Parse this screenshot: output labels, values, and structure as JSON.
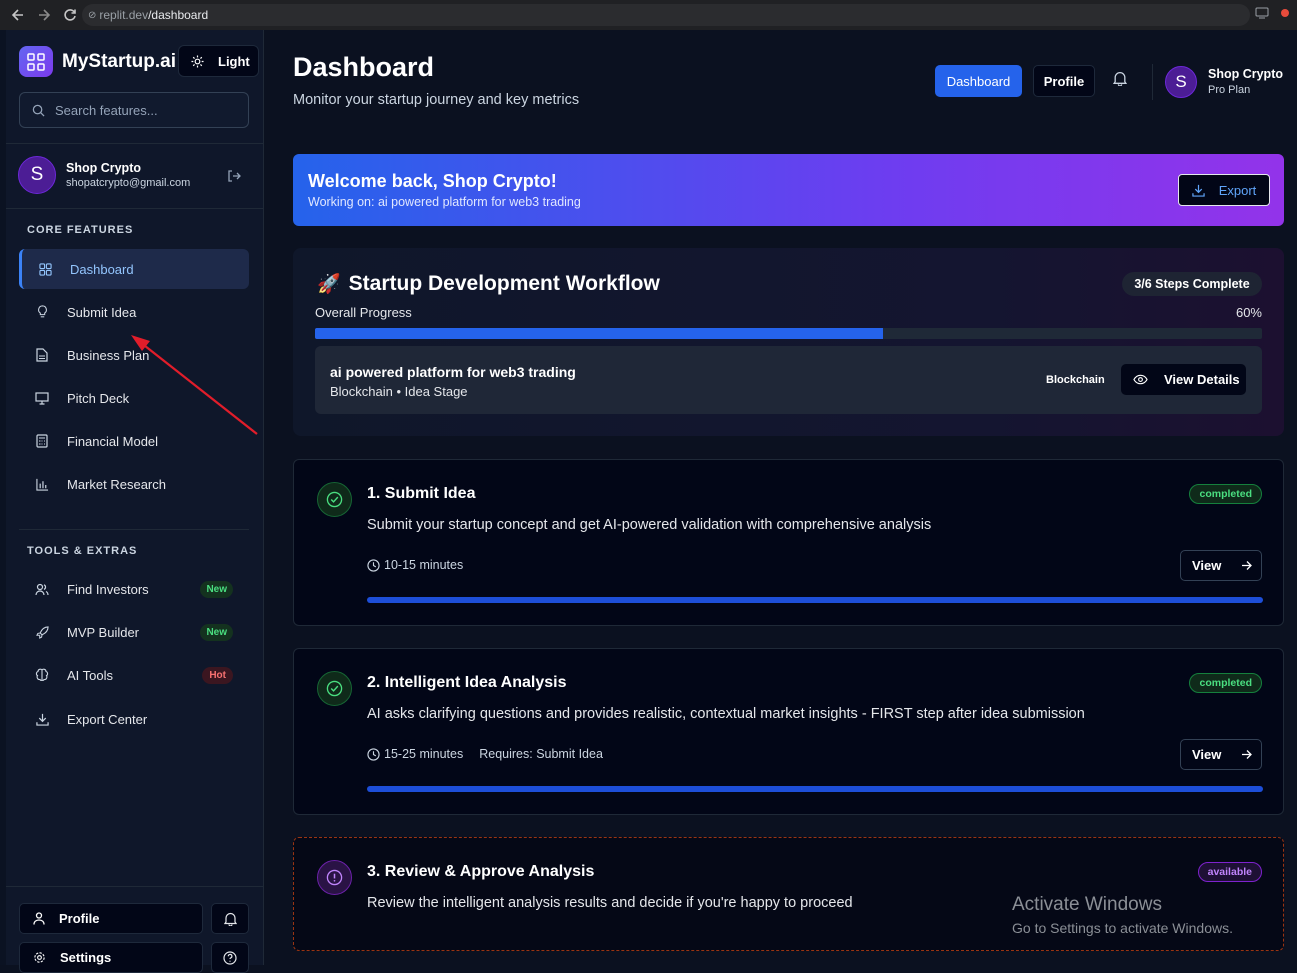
{
  "browser": {
    "url_host": "replit.dev",
    "url_path": "/dashboard"
  },
  "sidebar": {
    "brand": "MyStartup.ai",
    "theme_toggle": "Light",
    "search_placeholder": "Search features...",
    "user": {
      "initial": "S",
      "name": "Shop Crypto",
      "email": "shopatcrypto@gmail.com"
    },
    "core_title": "CORE FEATURES",
    "core_items": [
      {
        "label": "Dashboard",
        "icon": "grid-icon",
        "active": true
      },
      {
        "label": "Submit Idea",
        "icon": "lightbulb-icon"
      },
      {
        "label": "Business Plan",
        "icon": "document-icon"
      },
      {
        "label": "Pitch Deck",
        "icon": "presentation-icon"
      },
      {
        "label": "Financial Model",
        "icon": "calculator-icon"
      },
      {
        "label": "Market Research",
        "icon": "bar-chart-icon"
      }
    ],
    "tools_title": "TOOLS & EXTRAS",
    "tools_items": [
      {
        "label": "Find Investors",
        "icon": "users-icon",
        "badge": "New"
      },
      {
        "label": "MVP Builder",
        "icon": "rocket-icon",
        "badge": "New"
      },
      {
        "label": "AI Tools",
        "icon": "brain-icon",
        "badge": "Hot"
      },
      {
        "label": "Export Center",
        "icon": "download-icon"
      }
    ],
    "bottom": {
      "profile": "Profile",
      "settings": "Settings"
    }
  },
  "header": {
    "title": "Dashboard",
    "subtitle": "Monitor your startup journey and key metrics",
    "dashboard_btn": "Dashboard",
    "profile_btn": "Profile",
    "user": {
      "initial": "S",
      "name": "Shop Crypto",
      "plan": "Pro Plan"
    }
  },
  "welcome": {
    "title": "Welcome back, Shop Crypto!",
    "subtitle": "Working on: ai powered platform for web3 trading",
    "export": "Export"
  },
  "workflow": {
    "title": "Startup Development Workflow",
    "steps_badge": "3/6 Steps Complete",
    "progress_label": "Overall Progress",
    "progress_pct": "60%",
    "progress_value": 0.6,
    "idea_title": "ai powered platform for web3 trading",
    "idea_sub": "Blockchain • Idea Stage",
    "idea_tag": "Blockchain",
    "view_details": "View Details"
  },
  "steps": [
    {
      "title": "1. Submit Idea",
      "desc": "Submit your startup concept and get AI-powered validation with comprehensive analysis",
      "time": "10-15 minutes",
      "requires": "",
      "status": "completed",
      "view": "View"
    },
    {
      "title": "2. Intelligent Idea Analysis",
      "desc": "AI asks clarifying questions and provides realistic, contextual market insights - FIRST step after idea submission",
      "time": "15-25 minutes",
      "requires": "Requires: Submit Idea",
      "status": "completed",
      "view": "View"
    },
    {
      "title": "3. Review & Approve Analysis",
      "desc": "Review the intelligent analysis results and decide if you're happy to proceed",
      "status": "available"
    }
  ],
  "watermark": {
    "line1": "Activate Windows",
    "line2": "Go to Settings to activate Windows."
  },
  "colors": {
    "accent": "#2563eb",
    "completed": "#4ade80",
    "available": "#c084fc",
    "annotation_arrow": "#e11d2a"
  }
}
